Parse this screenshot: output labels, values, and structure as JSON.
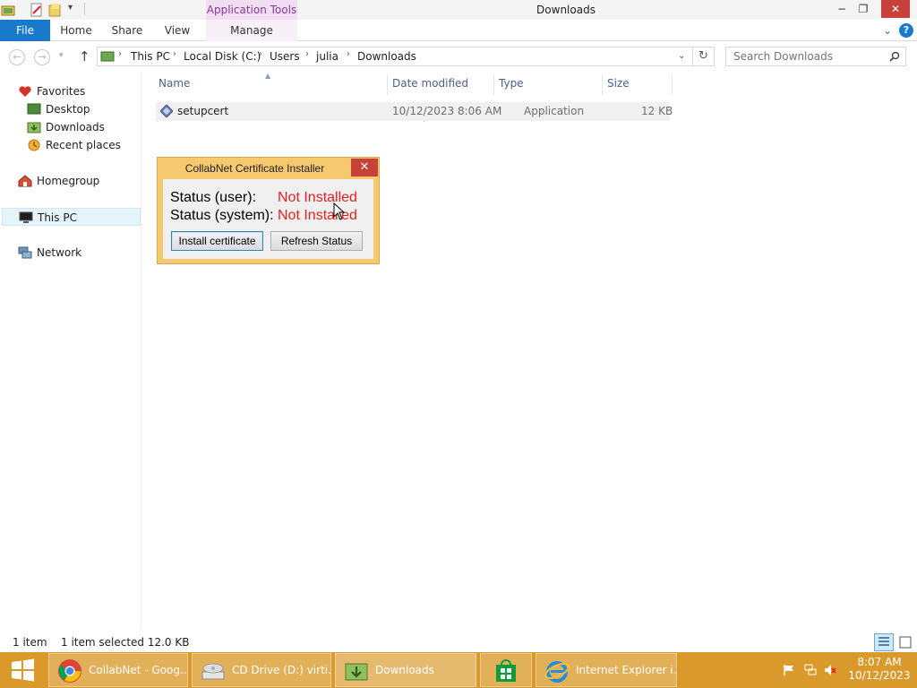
{
  "window": {
    "title": "Downloads",
    "context_tab_group": "Application Tools",
    "minimize": "−",
    "restore": "❐",
    "close": "✕",
    "help": "?",
    "ribbon_toggle": "⌄"
  },
  "ribbon": {
    "tabs": [
      "File",
      "Home",
      "Share",
      "View",
      "Manage"
    ]
  },
  "address": {
    "crumbs": [
      "This PC",
      "Local Disk (C:)",
      "Users",
      "julia",
      "Downloads"
    ],
    "refresh": "↻"
  },
  "search": {
    "placeholder": "Search Downloads"
  },
  "navpane": {
    "favorites": "Favorites",
    "desktop": "Desktop",
    "downloads": "Downloads",
    "recent": "Recent places",
    "homegroup": "Homegroup",
    "thispc": "This PC",
    "network": "Network"
  },
  "columns": {
    "name": "Name",
    "date": "Date modified",
    "type": "Type",
    "size": "Size"
  },
  "files": [
    {
      "name": "setupcert",
      "date": "10/12/2023 8:06 AM",
      "type": "Application",
      "size": "12 KB"
    }
  ],
  "dialog": {
    "title": "CollabNet Certificate Installer",
    "user_label": "Status (user):",
    "user_status": "Not Installed",
    "system_label": "Status (system):",
    "system_status": "Not Installed",
    "install_button": "Install certificate",
    "refresh_button": "Refresh Status",
    "close": "✕"
  },
  "statusbar": {
    "count": "1 item",
    "selection": "1 item selected  12.0 KB"
  },
  "taskbar": {
    "items": [
      {
        "label": "CollabNet - Goog..."
      },
      {
        "label": "CD Drive (D:) virti..."
      },
      {
        "label": "Downloads"
      },
      {
        "label": ""
      },
      {
        "label": "Internet Explorer i..."
      }
    ],
    "time": "8:07 AM",
    "date": "10/12/2023"
  },
  "colors": {
    "accent_file_tab": "#1979ca",
    "taskbar": "#d99a2b",
    "dialog_frame": "#f7c96f",
    "not_installed": "#e41f1f",
    "context_tab": "#8a3b94"
  }
}
